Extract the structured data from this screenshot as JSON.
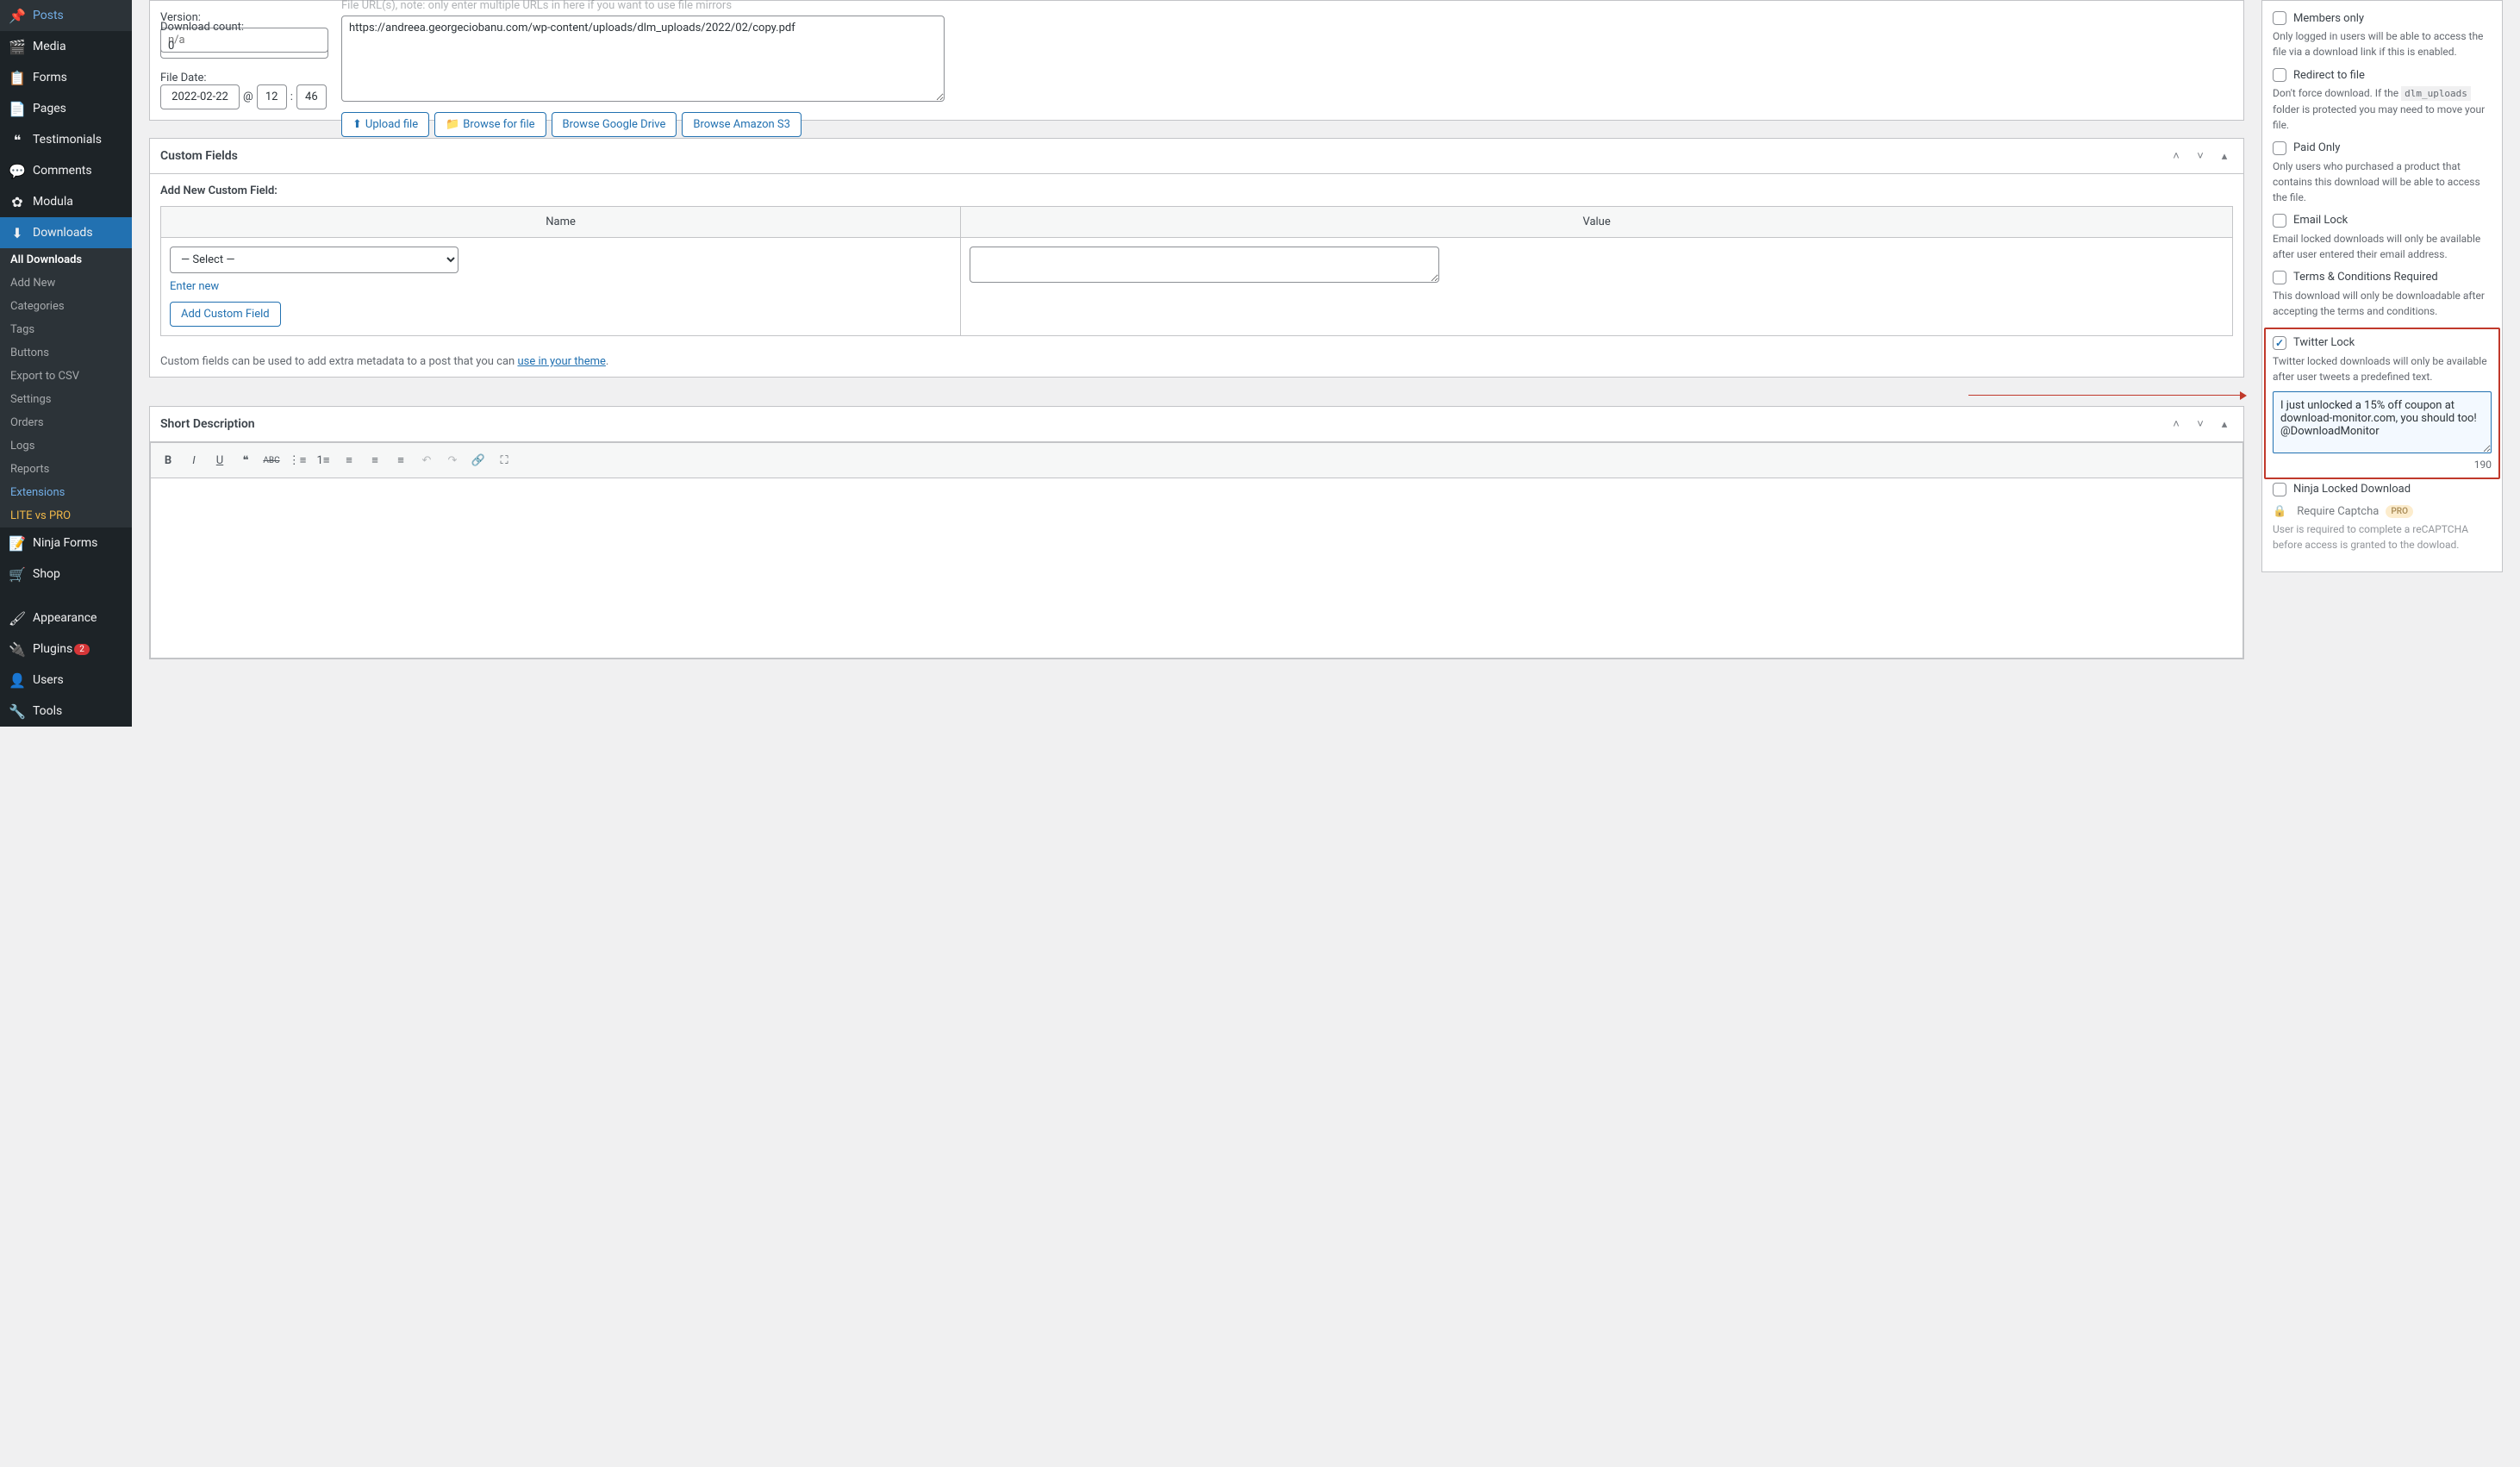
{
  "sidebar": {
    "items": [
      {
        "icon": "📌",
        "label": "Posts"
      },
      {
        "icon": "🎬",
        "label": "Media"
      },
      {
        "icon": "📋",
        "label": "Forms"
      },
      {
        "icon": "📄",
        "label": "Pages"
      },
      {
        "icon": "❝",
        "label": "Testimonials"
      },
      {
        "icon": "💬",
        "label": "Comments"
      },
      {
        "icon": "⚙",
        "label": "Modula"
      },
      {
        "icon": "⬇",
        "label": "Downloads"
      }
    ],
    "submenu": [
      "All Downloads",
      "Add New",
      "Categories",
      "Tags",
      "Buttons",
      "Export to CSV",
      "Settings",
      "Orders",
      "Logs",
      "Reports",
      "Extensions",
      "LITE vs PRO"
    ],
    "items2": [
      {
        "icon": "📝",
        "label": "Ninja Forms"
      },
      {
        "icon": "🛒",
        "label": "Shop"
      },
      {
        "icon": "🖌",
        "label": "Appearance"
      },
      {
        "icon": "🔌",
        "label": "Plugins",
        "badge": "2"
      },
      {
        "icon": "👤",
        "label": "Users"
      },
      {
        "icon": "🔧",
        "label": "Tools"
      }
    ]
  },
  "versionBox": {
    "versionLabel": "Version:",
    "versionPlaceholder": "n/a",
    "countLabel": "Download count:",
    "countValue": "0",
    "dateLabel": "File Date:",
    "dateValue": "2022-02-22",
    "atSymbol": "@",
    "hours": "12",
    "minutes": "46",
    "urlLabel": "File URL(s), note: only enter multiple URLs in here if you want to use file mirrors",
    "urlValue": "https://andreea.georgeciobanu.com/wp-content/uploads/dlm_uploads/2022/02/copy.pdf",
    "buttons": {
      "upload": "Upload file",
      "browseFile": "Browse for file",
      "browseDrive": "Browse Google Drive",
      "browseS3": "Browse Amazon S3"
    }
  },
  "customFields": {
    "title": "Custom Fields",
    "addHeading": "Add New Custom Field:",
    "nameHeader": "Name",
    "valueHeader": "Value",
    "selectPlaceholder": "— Select —",
    "enterNew": "Enter new",
    "addButton": "Add Custom Field",
    "footnote_prefix": "Custom fields can be used to add extra metadata to a post that you can ",
    "footnote_link": "use in your theme",
    "footnote_suffix": "."
  },
  "shortDesc": {
    "title": "Short Description"
  },
  "options": {
    "membersOnly": {
      "label": "Members only",
      "desc": "Only logged in users will be able to access the file via a download link if this is enabled."
    },
    "redirect": {
      "label": "Redirect to file",
      "desc_prefix": "Don't force download. If the ",
      "desc_code": "dlm_uploads",
      "desc_suffix": " folder is protected you may need to move your file."
    },
    "paidOnly": {
      "label": "Paid Only",
      "desc": "Only users who purchased a product that contains this download will be able to access the file."
    },
    "emailLock": {
      "label": "Email Lock",
      "desc": "Email locked downloads will only be available after user entered their email address."
    },
    "terms": {
      "label": "Terms & Conditions Required",
      "desc": "This download will only be downloadable after accepting the terms and conditions."
    },
    "twitterLock": {
      "label": "Twitter Lock",
      "desc": "Twitter locked downloads will only be available after user tweets a predefined text.",
      "tweetValue": "I just unlocked a 15% off coupon at download-monitor.com, you should too! @DownloadMonitor",
      "charCount": "190"
    },
    "ninjaLock": {
      "label": "Ninja Locked Download"
    },
    "captcha": {
      "label": "Require Captcha",
      "pro": "PRO",
      "desc": "User is required to complete a reCAPTCHA before access is granted to the dowload."
    }
  }
}
